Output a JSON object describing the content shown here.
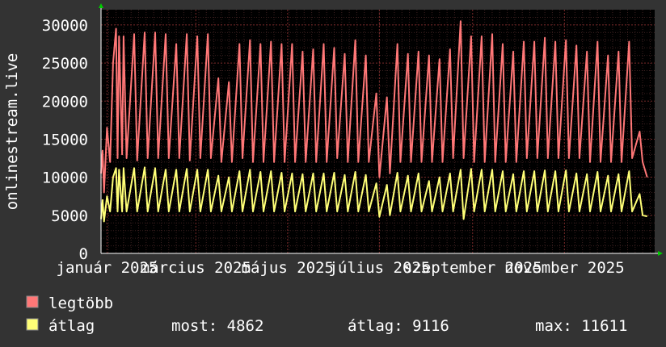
{
  "chart_data": {
    "type": "line",
    "ylabel": "onlinestream.live",
    "ylim": [
      0,
      32000
    ],
    "y_ticks": [
      {
        "value": 0,
        "label": "0"
      },
      {
        "value": 5000,
        "label": "5000"
      },
      {
        "value": 10000,
        "label": "10000"
      },
      {
        "value": 15000,
        "label": "15000"
      },
      {
        "value": 20000,
        "label": "20000"
      },
      {
        "value": 25000,
        "label": "25000"
      },
      {
        "value": 30000,
        "label": "30000"
      }
    ],
    "x_range": [
      "2024-12-28",
      "2025-12-31"
    ],
    "x_ticks": [
      {
        "date": "2025-01-01",
        "label": "január 2025"
      },
      {
        "date": "2025-03-01",
        "label": "március 2025"
      },
      {
        "date": "2025-05-01",
        "label": "május 2025"
      },
      {
        "date": "2025-07-01",
        "label": "július 2025"
      },
      {
        "date": "2025-09-01",
        "label": "szeptember 2025"
      },
      {
        "date": "2025-11-01",
        "label": "november 2025"
      }
    ],
    "grid": true,
    "legend_position": "bottom-left",
    "series": [
      {
        "name": "legtöbb",
        "color": "#ff7777",
        "x": [
          "2024-12-28",
          "2024-12-29",
          "2024-12-30",
          "2025-01-01",
          "2025-01-03",
          "2025-01-05",
          "2025-01-07",
          "2025-01-08",
          "2025-01-09",
          "2025-01-11",
          "2025-01-12",
          "2025-01-14",
          "2025-01-19",
          "2025-01-21",
          "2025-01-26",
          "2025-01-28",
          "2025-02-02",
          "2025-02-04",
          "2025-02-09",
          "2025-02-11",
          "2025-02-16",
          "2025-02-18",
          "2025-02-23",
          "2025-02-25",
          "2025-03-02",
          "2025-03-04",
          "2025-03-09",
          "2025-03-11",
          "2025-03-16",
          "2025-03-18",
          "2025-03-23",
          "2025-03-25",
          "2025-03-30",
          "2025-04-01",
          "2025-04-06",
          "2025-04-08",
          "2025-04-13",
          "2025-04-15",
          "2025-04-20",
          "2025-04-22",
          "2025-04-27",
          "2025-04-29",
          "2025-05-04",
          "2025-05-06",
          "2025-05-11",
          "2025-05-13",
          "2025-05-18",
          "2025-05-20",
          "2025-05-25",
          "2025-05-27",
          "2025-06-01",
          "2025-06-03",
          "2025-06-08",
          "2025-06-10",
          "2025-06-15",
          "2025-06-17",
          "2025-06-22",
          "2025-06-24",
          "2025-06-29",
          "2025-07-01",
          "2025-07-06",
          "2025-07-08",
          "2025-07-13",
          "2025-07-15",
          "2025-07-20",
          "2025-07-22",
          "2025-07-27",
          "2025-07-29",
          "2025-08-03",
          "2025-08-05",
          "2025-08-10",
          "2025-08-12",
          "2025-08-17",
          "2025-08-19",
          "2025-08-24",
          "2025-08-26",
          "2025-08-31",
          "2025-09-02",
          "2025-09-07",
          "2025-09-09",
          "2025-09-14",
          "2025-09-16",
          "2025-09-21",
          "2025-09-23",
          "2025-09-28",
          "2025-09-30",
          "2025-10-05",
          "2025-10-07",
          "2025-10-12",
          "2025-10-14",
          "2025-10-19",
          "2025-10-21",
          "2025-10-26",
          "2025-10-28",
          "2025-11-02",
          "2025-11-04",
          "2025-11-09",
          "2025-11-11",
          "2025-11-16",
          "2025-11-18",
          "2025-11-23",
          "2025-11-25",
          "2025-11-30",
          "2025-12-02",
          "2025-12-07",
          "2025-12-09",
          "2025-12-14",
          "2025-12-16",
          "2025-12-21",
          "2025-12-23",
          "2025-12-26"
        ],
        "values": [
          10500,
          13500,
          8000,
          16500,
          12000,
          25000,
          29500,
          12500,
          28500,
          13000,
          28500,
          12500,
          28800,
          12200,
          29000,
          12500,
          29000,
          12500,
          28800,
          12500,
          27500,
          12500,
          28800,
          12200,
          28500,
          12500,
          28800,
          12500,
          23000,
          12000,
          22500,
          12000,
          27500,
          12500,
          28000,
          12000,
          27500,
          12000,
          27800,
          12000,
          27500,
          12000,
          27500,
          12000,
          26500,
          12000,
          26800,
          12000,
          27500,
          12000,
          27000,
          12500,
          26200,
          12000,
          28000,
          12000,
          26000,
          12000,
          21000,
          10000,
          20500,
          10500,
          27500,
          12000,
          26200,
          12000,
          26500,
          12000,
          26000,
          12000,
          25500,
          12000,
          26800,
          12500,
          30500,
          12500,
          28500,
          12000,
          28500,
          12000,
          28800,
          12000,
          27500,
          12000,
          26500,
          12000,
          27800,
          12500,
          27800,
          12500,
          28300,
          12500,
          27800,
          12500,
          28000,
          12500,
          27300,
          12500,
          26500,
          12000,
          27800,
          12000,
          26000,
          12000,
          26500,
          12000,
          27800,
          12500,
          16000,
          12000,
          10000
        ]
      },
      {
        "name": "átlag",
        "color": "#ffff77",
        "x": [
          "2024-12-28",
          "2024-12-29",
          "2024-12-30",
          "2025-01-01",
          "2025-01-03",
          "2025-01-05",
          "2025-01-07",
          "2025-01-08",
          "2025-01-09",
          "2025-01-11",
          "2025-01-12",
          "2025-01-14",
          "2025-01-19",
          "2025-01-21",
          "2025-01-26",
          "2025-01-28",
          "2025-02-02",
          "2025-02-04",
          "2025-02-09",
          "2025-02-11",
          "2025-02-16",
          "2025-02-18",
          "2025-02-23",
          "2025-02-25",
          "2025-03-02",
          "2025-03-04",
          "2025-03-09",
          "2025-03-11",
          "2025-03-16",
          "2025-03-18",
          "2025-03-23",
          "2025-03-25",
          "2025-03-30",
          "2025-04-01",
          "2025-04-06",
          "2025-04-08",
          "2025-04-13",
          "2025-04-15",
          "2025-04-20",
          "2025-04-22",
          "2025-04-27",
          "2025-04-29",
          "2025-05-04",
          "2025-05-06",
          "2025-05-11",
          "2025-05-13",
          "2025-05-18",
          "2025-05-20",
          "2025-05-25",
          "2025-05-27",
          "2025-06-01",
          "2025-06-03",
          "2025-06-08",
          "2025-06-10",
          "2025-06-15",
          "2025-06-17",
          "2025-06-22",
          "2025-06-24",
          "2025-06-29",
          "2025-07-01",
          "2025-07-06",
          "2025-07-08",
          "2025-07-13",
          "2025-07-15",
          "2025-07-20",
          "2025-07-22",
          "2025-07-27",
          "2025-07-29",
          "2025-08-03",
          "2025-08-05",
          "2025-08-10",
          "2025-08-12",
          "2025-08-17",
          "2025-08-19",
          "2025-08-24",
          "2025-08-26",
          "2025-08-31",
          "2025-09-02",
          "2025-09-07",
          "2025-09-09",
          "2025-09-14",
          "2025-09-16",
          "2025-09-21",
          "2025-09-23",
          "2025-09-28",
          "2025-09-30",
          "2025-10-05",
          "2025-10-07",
          "2025-10-12",
          "2025-10-14",
          "2025-10-19",
          "2025-10-21",
          "2025-10-26",
          "2025-10-28",
          "2025-11-02",
          "2025-11-04",
          "2025-11-09",
          "2025-11-11",
          "2025-11-16",
          "2025-11-18",
          "2025-11-23",
          "2025-11-25",
          "2025-11-30",
          "2025-12-02",
          "2025-12-07",
          "2025-12-09",
          "2025-12-14",
          "2025-12-16",
          "2025-12-21",
          "2025-12-23",
          "2025-12-26"
        ],
        "values": [
          4500,
          7000,
          4200,
          7500,
          5500,
          10000,
          11200,
          5500,
          11000,
          5500,
          11200,
          5500,
          11200,
          5500,
          11300,
          5500,
          11200,
          5500,
          11000,
          5500,
          11000,
          5500,
          11100,
          5500,
          11000,
          5500,
          11000,
          5500,
          10200,
          5500,
          10000,
          5500,
          10800,
          5500,
          11000,
          5500,
          10700,
          5500,
          10800,
          5500,
          10600,
          5500,
          10500,
          5500,
          10400,
          5500,
          10500,
          5500,
          10500,
          5500,
          10600,
          5500,
          10300,
          5500,
          10700,
          5500,
          10300,
          5500,
          9200,
          4800,
          9000,
          5000,
          10600,
          5500,
          10200,
          5500,
          10500,
          5500,
          9500,
          5500,
          10000,
          5500,
          10500,
          5500,
          11000,
          4500,
          11100,
          5500,
          11000,
          5500,
          11000,
          5500,
          10800,
          5500,
          10400,
          5500,
          10800,
          5500,
          10800,
          5500,
          10900,
          5500,
          10800,
          5500,
          10900,
          5500,
          10500,
          5500,
          10400,
          5500,
          10700,
          5500,
          10200,
          5500,
          10400,
          5500,
          10800,
          5500,
          7800,
          5000,
          4862
        ]
      }
    ]
  },
  "legend": {
    "items": [
      {
        "label": "legtöbb",
        "color": "#ff7777"
      },
      {
        "label": "átlag",
        "color": "#ffff77"
      }
    ],
    "stats": {
      "most": "most: 4862",
      "atlag": "átlag: 9116",
      "max": "max: 11611"
    }
  }
}
